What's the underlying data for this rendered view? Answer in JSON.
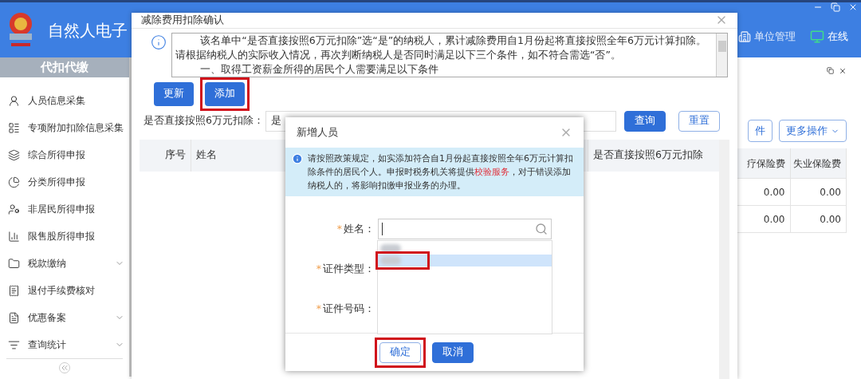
{
  "app": {
    "title": "自然人电子",
    "header_links": [
      {
        "label": "单位管理",
        "kind": "building"
      },
      {
        "label": "在线",
        "kind": "monitor"
      }
    ]
  },
  "sidebar": {
    "section": "代扣代缴",
    "items": [
      {
        "label": "人员信息采集",
        "expandable": false
      },
      {
        "label": "专项附加扣除信息采集",
        "expandable": false
      },
      {
        "label": "综合所得申报",
        "expandable": false
      },
      {
        "label": "分类所得申报",
        "expandable": false
      },
      {
        "label": "非居民所得申报",
        "expandable": false
      },
      {
        "label": "限售股所得申报",
        "expandable": false
      },
      {
        "label": "税款缴纳",
        "expandable": true
      },
      {
        "label": "退付手续费核对",
        "expandable": false
      },
      {
        "label": "优惠备案",
        "expandable": true
      },
      {
        "label": "查询统计",
        "expandable": true
      }
    ]
  },
  "background_panel": {
    "buttons": [
      {
        "label": "件",
        "dropdown": false
      },
      {
        "label": "更多操作",
        "dropdown": true
      }
    ],
    "columns": [
      "疗保险费",
      "失业保险费"
    ],
    "rows": [
      [
        "0.00",
        "0.00"
      ],
      [
        "0.00",
        "0.00"
      ]
    ]
  },
  "dialog": {
    "title": "减除费用扣除确认",
    "notice": [
      "该名单中“是否直接按照6万元扣除”选“是”的纳税人，累计减除费用自1月份起将直接按照全年6万元计算扣除。请根据纳税人的实际收入情况，再次判断纳税人是否同时满足以下三个条件，如不符合需选“否”。",
      "一、取得工资薪金所得的居民个人需要满足以下条件"
    ],
    "buttons": [
      {
        "label": "更新",
        "highlighted": false
      },
      {
        "label": "添加",
        "highlighted": true
      }
    ],
    "filter": {
      "label": "是否直接按照6万元扣除：",
      "value": "是"
    },
    "actions": [
      {
        "label": "查询",
        "kind": "primary"
      },
      {
        "label": "重置",
        "kind": "secondary"
      }
    ],
    "columns": [
      "序号",
      "姓名",
      "是否直接按照6万元扣除"
    ]
  },
  "sub_dialog": {
    "title": "新增人员",
    "notice": {
      "before": "请按照政策规定，如实添加符合自1月份起直接按照全年6万元计算扣除条件的居民个人。申报时税务机关将提供",
      "link": "校验服务",
      "after": "，对于错误添加纳税人的，将影响扣缴申报业务的办理。"
    },
    "fields": [
      {
        "label": "姓名：",
        "required_mark": "*"
      },
      {
        "label": "证件类型：",
        "required_mark": "*"
      },
      {
        "label": "证件号码：",
        "required_mark": "*"
      }
    ],
    "options": [
      {
        "selected": false,
        "highlighted": false
      },
      {
        "selected": true,
        "highlighted": true
      }
    ],
    "buttons": [
      {
        "label": "确定",
        "kind": "secondary",
        "highlighted": true
      },
      {
        "label": "取消",
        "kind": "primary",
        "highlighted": false
      }
    ]
  }
}
